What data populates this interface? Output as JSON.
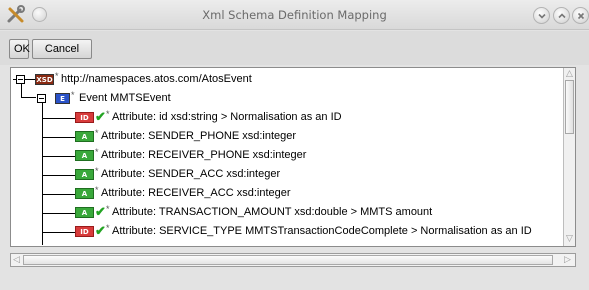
{
  "window": {
    "title": "Xml Schema Definition Mapping",
    "app_icon": "tools-icon",
    "controls": [
      "minimize-icon",
      "maximize-icon",
      "close-icon"
    ]
  },
  "toolbar": {
    "ok_label": "OK",
    "cancel_label": "Cancel"
  },
  "tree": {
    "nodes": [
      {
        "badge": "XSD",
        "star": "*",
        "label": "http://namespaces.atos.com/AtosEvent",
        "mapped": false
      },
      {
        "badge": "E",
        "star": "*",
        "label": "Event MMTSEvent",
        "mapped": false
      },
      {
        "badge": "ID",
        "star": "*",
        "label": "Attribute: id xsd:string > Normalisation as an ID",
        "mapped": true
      },
      {
        "badge": "A",
        "star": "*",
        "label": "Attribute: SENDER_PHONE xsd:integer",
        "mapped": false
      },
      {
        "badge": "A",
        "star": "*",
        "label": "Attribute: RECEIVER_PHONE xsd:integer",
        "mapped": false
      },
      {
        "badge": "A",
        "star": "*",
        "label": "Attribute: SENDER_ACC xsd:integer",
        "mapped": false
      },
      {
        "badge": "A",
        "star": "*",
        "label": "Attribute: RECEIVER_ACC xsd:integer",
        "mapped": false
      },
      {
        "badge": "A",
        "star": "*",
        "label": "Attribute: TRANSACTION_AMOUNT xsd:double > MMTS amount",
        "mapped": true
      },
      {
        "badge": "ID",
        "star": "*",
        "label": "Attribute: SERVICE_TYPE MMTSTransactionCodeComplete > Normalisation as an ID",
        "mapped": true
      }
    ]
  },
  "colors": {
    "badge_xsd": "#8a2a12",
    "badge_element": "#2a52c8",
    "badge_id": "#d83b3b",
    "badge_attribute": "#39a83a",
    "check": "#23a423"
  }
}
